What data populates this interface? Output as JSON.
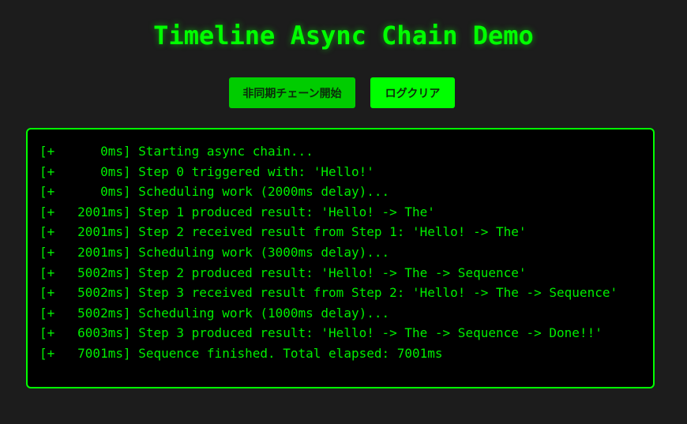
{
  "page": {
    "title": "Timeline Async Chain Demo"
  },
  "buttons": {
    "start_label": "非同期チェーン開始",
    "clear_label": "ログクリア"
  },
  "log": {
    "lines": [
      "[+      0ms] Starting async chain...",
      "[+      0ms] Step 0 triggered with: 'Hello!'",
      "[+      0ms] Scheduling work (2000ms delay)...",
      "[+   2001ms] Step 1 produced result: 'Hello! -> The'",
      "[+   2001ms] Step 2 received result from Step 1: 'Hello! -> The'",
      "[+   2001ms] Scheduling work (3000ms delay)...",
      "[+   5002ms] Step 2 produced result: 'Hello! -> The -> Sequence'",
      "[+   5002ms] Step 3 received result from Step 2: 'Hello! -> The -> Sequence'",
      "[+   5002ms] Scheduling work (1000ms delay)...",
      "[+   6003ms] Step 3 produced result: 'Hello! -> The -> Sequence -> Done!!'",
      "[+   7001ms] Sequence finished. Total elapsed: 7001ms"
    ]
  },
  "colors": {
    "accent": "#00ff00",
    "background": "#1c1c1c",
    "log_background": "#000000"
  }
}
